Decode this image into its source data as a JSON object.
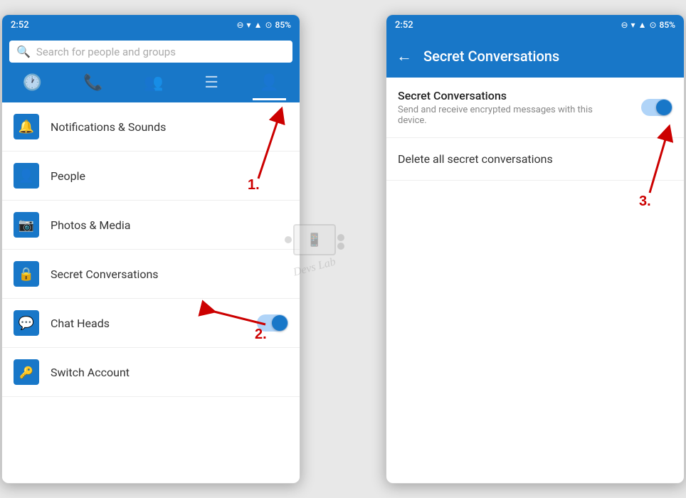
{
  "phone1": {
    "statusBar": {
      "time": "2:52",
      "battery": "85%"
    },
    "searchPlaceholder": "Search for people and groups",
    "navTabs": [
      {
        "id": "recent",
        "icon": "🕐",
        "active": false
      },
      {
        "id": "calls",
        "icon": "📞",
        "active": false
      },
      {
        "id": "groups",
        "icon": "👥",
        "active": false
      },
      {
        "id": "menu",
        "icon": "☰",
        "active": false
      },
      {
        "id": "account",
        "icon": "👤",
        "active": true
      }
    ],
    "menuItems": [
      {
        "id": "notifications",
        "label": "Notifications & Sounds",
        "iconType": "bell",
        "iconChar": "🔔",
        "hasToggle": false
      },
      {
        "id": "people",
        "label": "People",
        "iconType": "person",
        "iconChar": "👤",
        "hasToggle": false
      },
      {
        "id": "photos",
        "label": "Photos & Media",
        "iconType": "camera",
        "iconChar": "📷",
        "hasToggle": false
      },
      {
        "id": "secret",
        "label": "Secret Conversations",
        "iconType": "lock",
        "iconChar": "🔒",
        "hasToggle": false
      },
      {
        "id": "chatheads",
        "label": "Chat Heads",
        "iconType": "chat",
        "iconChar": "💬",
        "hasToggle": true,
        "toggleOn": true
      },
      {
        "id": "switchaccount",
        "label": "Switch Account",
        "iconType": "key",
        "iconChar": "🔑",
        "hasToggle": false
      }
    ],
    "annotations": {
      "arrow1Label": "1.",
      "arrow2Label": "2."
    }
  },
  "phone2": {
    "statusBar": {
      "time": "2:52",
      "battery": "85%"
    },
    "header": {
      "title": "Secret Conversations",
      "backArrow": "←"
    },
    "settings": [
      {
        "id": "secret-conv-toggle",
        "title": "Secret Conversations",
        "subtitle": "Send and receive encrypted messages with this device.",
        "hasToggle": true,
        "toggleOn": true
      }
    ],
    "deleteItem": "Delete all secret conversations",
    "annotations": {
      "arrow3Label": "3."
    }
  }
}
